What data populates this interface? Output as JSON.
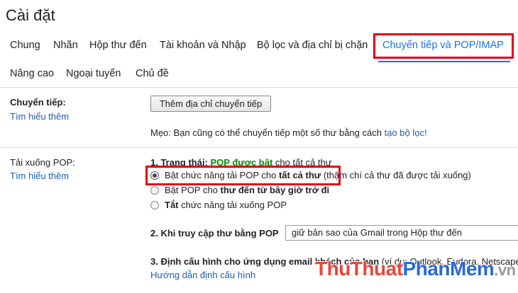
{
  "page": {
    "title": "Cài đặt"
  },
  "tabs_row1": [
    {
      "label": "Chung"
    },
    {
      "label": "Nhãn"
    },
    {
      "label": "Hộp thư đến"
    },
    {
      "label": "Tài khoản và Nhập"
    },
    {
      "label": "Bộ lọc và địa chỉ bị chặn"
    },
    {
      "label": "Chuyển tiếp và POP/IMAP"
    }
  ],
  "tabs_row2": [
    {
      "label": "Nâng cao"
    },
    {
      "label": "Ngoại tuyến"
    },
    {
      "label": "Chủ đề"
    }
  ],
  "forwarding": {
    "label": "Chuyển tiếp:",
    "learn_more": "Tìm hiểu thêm",
    "add_button": "Thêm địa chỉ chuyển tiếp",
    "tip_prefix": "Mẹo: Bạn cũng có thể chuyển tiếp một số thư bằng cách ",
    "tip_link": "tạo bộ lọc!"
  },
  "pop": {
    "label": "Tải xuống POP:",
    "learn_more": "Tìm hiểu thêm",
    "status_prefix": "1. Trạng thái: ",
    "status_value": "POP được bật",
    "status_suffix": " cho tất cả thư",
    "options": [
      {
        "pre": "Bật chức năng tải POP cho ",
        "bold": "tất cả thư",
        "post": " (thậm chí cả thư đã được tải xuống)",
        "checked": true
      },
      {
        "pre": "Bật POP cho ",
        "bold": "thư đến từ bây giờ trở đi",
        "post": "",
        "checked": false
      },
      {
        "pre": "",
        "bold": "Tắt",
        "post": " chức năng tải xuống POP",
        "checked": false
      }
    ],
    "access_label": "2. Khi truy cập thư bằng POP",
    "access_select": "giữ bản sao của Gmail trong Hộp thư đến",
    "config_label": "3. Định cấu hình cho ứng dụng email khách của bạn",
    "config_suffix": " (ví dụ: Outlook, Eudora, Netscape Mail)",
    "config_link": "Hướng dẫn định cấu hình"
  },
  "watermark": {
    "part1": "Thu",
    "part2": "Thuat",
    "part3": "Phan",
    "part4": "Mem",
    "part5": ".vn"
  }
}
